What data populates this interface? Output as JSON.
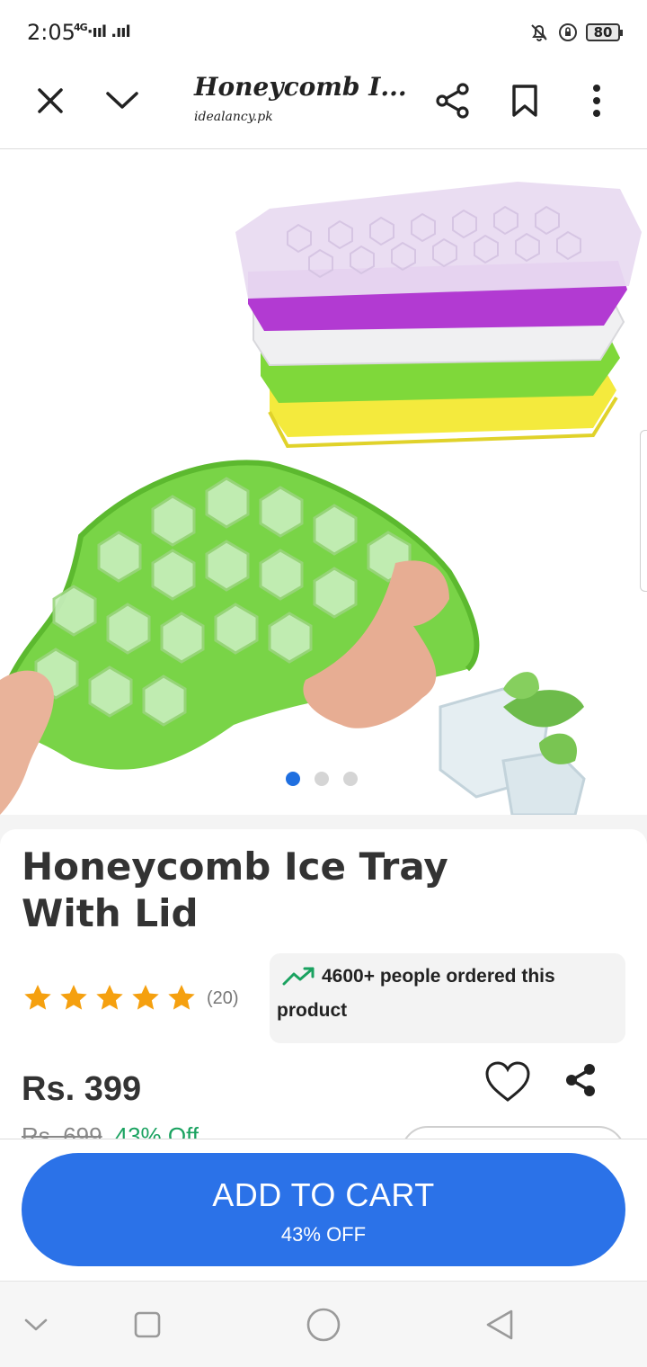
{
  "status_bar": {
    "time": "2:05",
    "network": "4G",
    "signal_icons": "·ııl .ııl",
    "battery": "80"
  },
  "browser": {
    "title": "Honeycomb I...",
    "url": "idealancy.pk"
  },
  "carousel": {
    "total": 3,
    "active": 0
  },
  "product": {
    "title": "Honeycomb Ice Tray With Lid",
    "rating_stars": 5,
    "rating_count": "(20)",
    "orders_text_line1": "4600+ people ordered this",
    "orders_text_line2": "product",
    "price": "Rs. 399",
    "old_price": "Rs. 699",
    "discount": "43% Off"
  },
  "cart": {
    "label": "ADD TO CART",
    "sublabel": "43% OFF"
  },
  "colors": {
    "accent": "#2b72e8",
    "star": "#f5a00f",
    "trend": "#1aa260",
    "dot_active": "#1f6fe0"
  },
  "icons": {
    "header": [
      "close-icon",
      "chevron-down-icon",
      "share-icon",
      "bookmark-icon",
      "more-vertical-icon"
    ],
    "nav": [
      "nav-down-icon",
      "recent-apps-icon",
      "home-icon",
      "back-icon"
    ]
  }
}
